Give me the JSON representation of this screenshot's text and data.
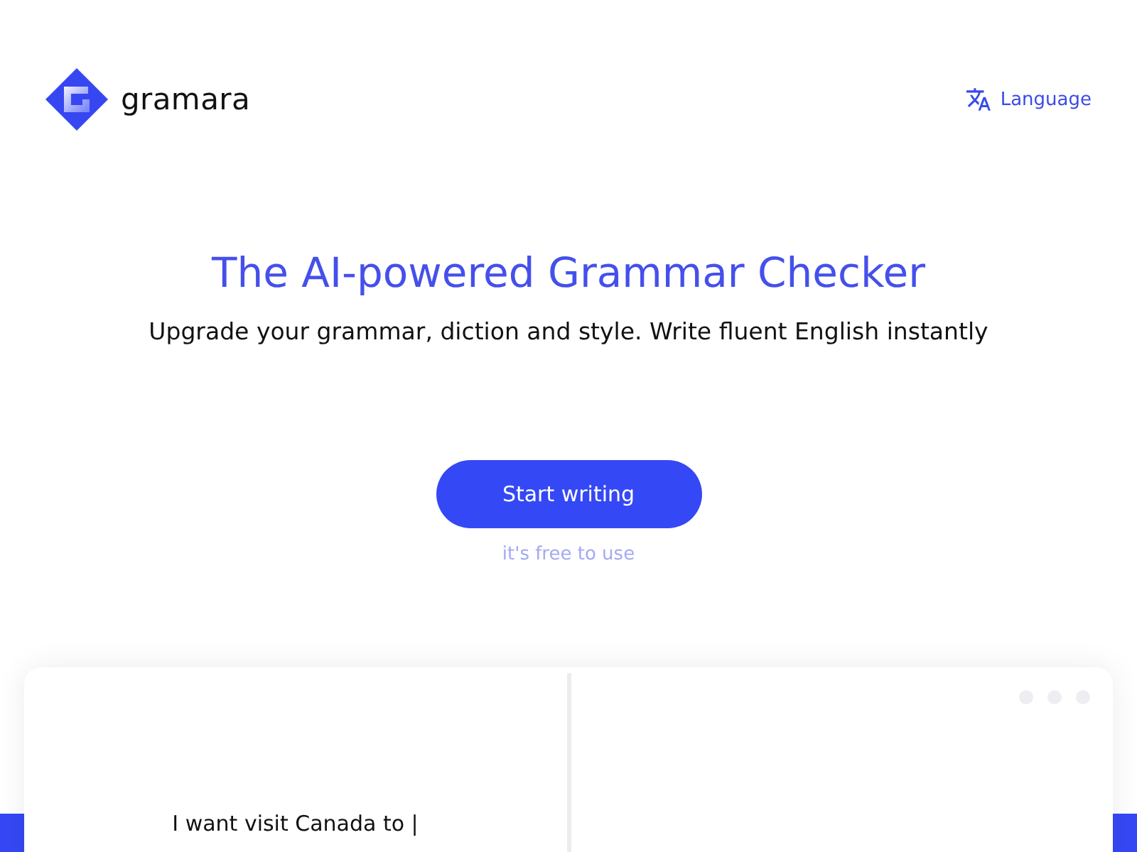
{
  "header": {
    "logo": {
      "name": "gramara"
    },
    "language_link": {
      "label": "Language"
    }
  },
  "hero": {
    "title": "The AI-powered Grammar Checker",
    "subtitle": "Upgrade your grammar, diction and style. Write fluent English instantly",
    "cta_button": {
      "label": "Start writing"
    },
    "cta_note": "it's free to use"
  },
  "demo": {
    "input_text": "I want visit Canada to |"
  }
}
